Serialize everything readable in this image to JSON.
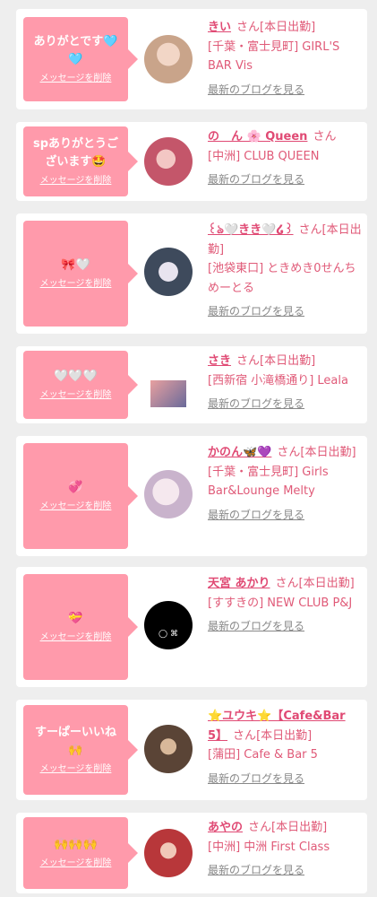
{
  "delete_label": "メッセージを削除",
  "blog_label": "最新のブログを見る",
  "san_label": "さん",
  "cards": [
    {
      "message": "ありがとです🩵🩵",
      "name": "きい",
      "status": "[本日出勤]",
      "shop": "[千葉・富士見町] GIRL'S BAR Vis",
      "avatar_color": "#c9a48a"
    },
    {
      "message": "spありがとうございます🤩",
      "name": "の　ん 🌸 Queen",
      "status": "",
      "shop": "[中洲] CLUB QUEEN",
      "avatar_color": "#c4566a"
    },
    {
      "message": "🎀🤍",
      "name": "꒰ঌ🤍きき🤍໒꒱",
      "status": "[本日出勤]",
      "shop": "[池袋東口] ときめき0せんちめーとる",
      "avatar_color": "#3e4a5c"
    },
    {
      "message": "🤍🤍🤍",
      "name": "さき",
      "status": "[本日出勤]",
      "shop": "[西新宿 小滝橋通り] Leala",
      "avatar_color": "#b07a8c"
    },
    {
      "message": "💞",
      "name": "かのん🦋💜",
      "status": "[本日出勤]",
      "shop": "[千葉・富士見町] Girls Bar&Lounge Melty",
      "avatar_color": "#e7dbe8"
    },
    {
      "message": "💝",
      "name": "天宮 あかり",
      "status": "[本日出勤]",
      "shop": "[すすきの] NEW CLUB P&J",
      "avatar_color": "#000000",
      "avatar_text": "◯ ⌘"
    },
    {
      "message": "すーぱーいいね🙌",
      "name": "⭐ユウキ⭐【Cafe&Bar 5】",
      "status": "[本日出勤]",
      "shop": "[蒲田] Cafe & Bar 5",
      "avatar_color": "#5a4436"
    },
    {
      "message": "🙌🙌🙌",
      "name": "あやの",
      "status": "[本日出勤]",
      "shop": "[中洲] 中洲 First Class",
      "avatar_color": "#b8373a"
    }
  ]
}
